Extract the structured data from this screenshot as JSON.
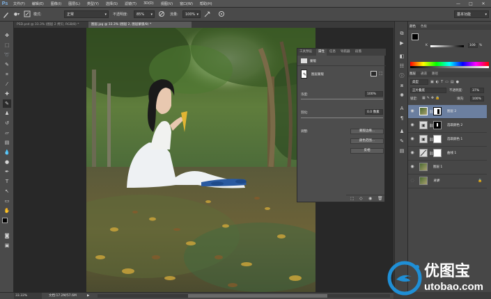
{
  "app": {
    "logo": "Ps"
  },
  "menu": [
    "文件(F)",
    "编辑(E)",
    "图像(I)",
    "图层(L)",
    "类型(Y)",
    "选择(S)",
    "滤镜(T)",
    "3D(D)",
    "视图(V)",
    "窗口(W)",
    "帮助(H)"
  ],
  "window_controls": [
    "—",
    "□",
    "✕"
  ],
  "options": {
    "mode_label": "模式:",
    "mode_value": "正常",
    "opacity_label": "不透明度:",
    "opacity_value": "85%",
    "flow_label": "流量:",
    "flow_value": "100%",
    "workspace": "基本功能"
  },
  "tabs": [
    {
      "label": "PSD.psd @ 33.3% (图层 2 拷贝, RGB/8) *",
      "active": false
    },
    {
      "label": "图层.jpg @ 33.3% (图层 2, 图层蒙版/8) *",
      "active": true
    }
  ],
  "status": {
    "zoom": "33.33%",
    "doc": "文档:17.2M/57.6M"
  },
  "properties": {
    "tabs": [
      "工具预设",
      "属性",
      "信息",
      "导航器",
      "段落"
    ],
    "header": "蒙版",
    "mask_type": "图层蒙版",
    "density_label": "浓度:",
    "density_value": "100%",
    "feather_label": "羽化:",
    "feather_value": "0.0 像素",
    "refine_label": "调整:",
    "buttons": [
      "蒙版边缘...",
      "颜色范围...",
      "反相"
    ]
  },
  "color_panel": {
    "tabs": [
      "颜色",
      "色板"
    ],
    "k_label": "K",
    "k_value": "100",
    "percent": "%"
  },
  "adjust_panel": {
    "tabs": [
      "调整",
      "样式"
    ]
  },
  "layers_panel": {
    "tabs": [
      "图层",
      "通道",
      "路径"
    ],
    "kind": "类型",
    "blend_mode": "正片叠底",
    "opacity_label": "不透明度:",
    "opacity_value": "37%",
    "lock_label": "锁定:",
    "fill_label": "填充:",
    "fill_value": "100%",
    "layers": [
      {
        "name": "图层 2",
        "selected": true,
        "italic": false,
        "thumb": "photo",
        "mask": "white-black"
      },
      {
        "name": "选取颜色 2",
        "selected": false,
        "italic": false,
        "thumb": "adjust",
        "mask": "black"
      },
      {
        "name": "选取颜色 1",
        "selected": false,
        "italic": false,
        "thumb": "adjust",
        "mask": "white"
      },
      {
        "name": "曲线 1",
        "selected": false,
        "italic": false,
        "thumb": "curve",
        "mask": "white"
      },
      {
        "name": "图层 1",
        "selected": false,
        "italic": false,
        "thumb": "photo",
        "mask": ""
      },
      {
        "name": "背景",
        "selected": false,
        "italic": true,
        "thumb": "photo",
        "mask": ""
      }
    ]
  },
  "watermark": {
    "name": "优图宝",
    "url": "utobao.com"
  },
  "colors": {
    "accent": "#1f8fd6",
    "panel": "#474747",
    "selected_layer": "#6b7fa0"
  }
}
